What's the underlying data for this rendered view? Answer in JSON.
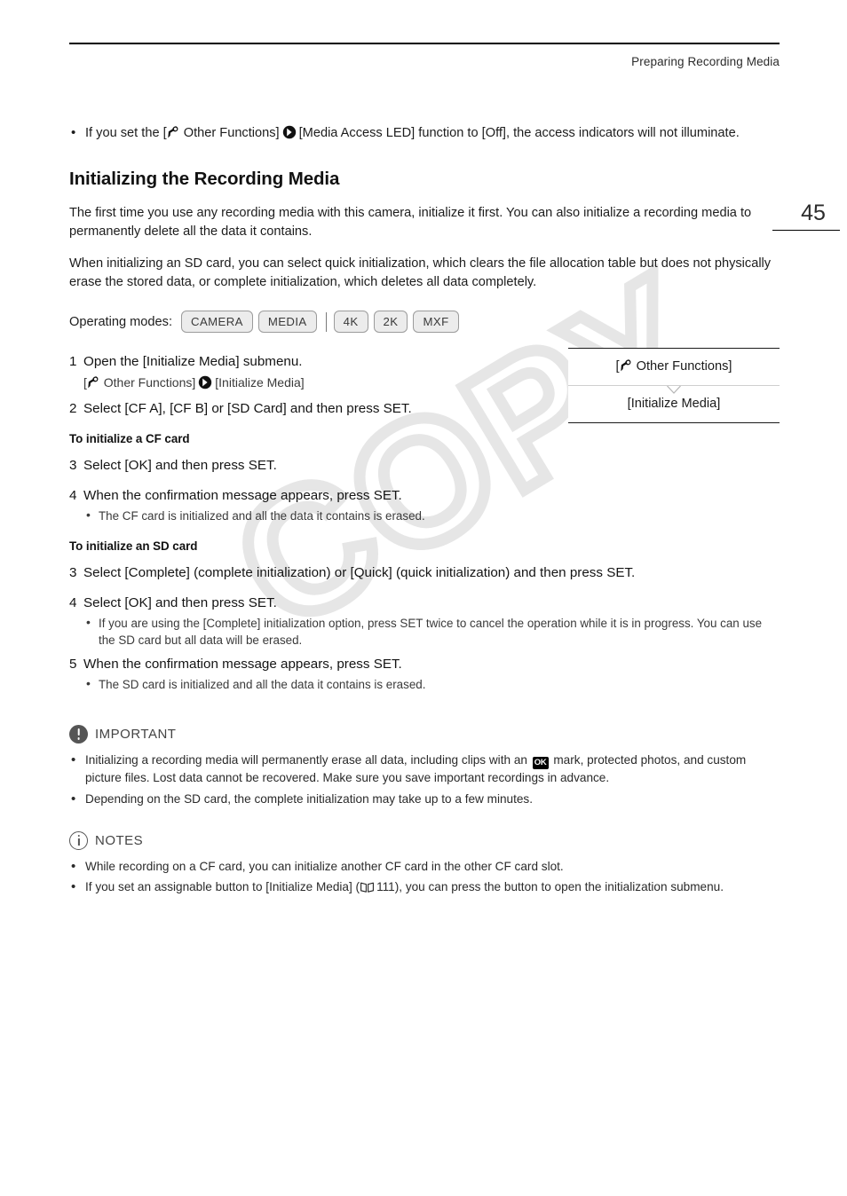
{
  "page": {
    "header_title": "Preparing Recording Media",
    "page_number": "45",
    "watermark": "COPY"
  },
  "intro_bullet": {
    "text_before_wrench": "If you set the [",
    "text_after_wrench": "Other Functions]",
    "text_after_arrow": "[Media Access LED] function to [Off], the access indicators will not illuminate."
  },
  "section": {
    "title": "Initializing the Recording Media",
    "para1": "The first time you use any recording media with this camera, initialize it first. You can also initialize a recording media to permanently delete all the data it contains.",
    "para2": "When initializing an SD card, you can select quick initialization, which clears the file allocation table but does not physically erase the stored data, or complete initialization, which deletes all data completely."
  },
  "operating_modes": {
    "label": "Operating modes:",
    "badges_primary": [
      "CAMERA",
      "MEDIA"
    ],
    "badges_secondary": [
      "4K",
      "2K",
      "MXF"
    ]
  },
  "steps_common": [
    {
      "num": "1",
      "text": "Open the [Initialize Media] submenu.",
      "sub_before_wrench": "[",
      "sub_after_wrench": "Other Functions]",
      "sub_after_arrow": "[Initialize Media]"
    },
    {
      "num": "2",
      "text": "Select [CF A], [CF B] or [SD Card] and then press SET."
    }
  ],
  "menu_path_box": {
    "row1_before_wrench": "[",
    "row1_after_wrench": "Other Functions]",
    "row2": "[Initialize Media]"
  },
  "cf_section": {
    "subhead": "To initialize a CF card",
    "steps": [
      {
        "num": "3",
        "text": "Select [OK] and then press SET.",
        "bullets": []
      },
      {
        "num": "4",
        "text": "When the confirmation message appears, press SET.",
        "bullets": [
          "The CF card is initialized and all the data it contains is erased."
        ]
      }
    ]
  },
  "sd_section": {
    "subhead": "To initialize an SD card",
    "steps": [
      {
        "num": "3",
        "text": "Select [Complete] (complete initialization) or [Quick] (quick initialization) and then press SET.",
        "bullets": []
      },
      {
        "num": "4",
        "text": "Select [OK] and then press SET.",
        "bullets": [
          "If you are using the [Complete] initialization option, press SET twice to cancel the operation while it is in progress. You can use the SD card but all data will be erased."
        ]
      },
      {
        "num": "5",
        "text": "When the confirmation message appears, press SET.",
        "bullets": [
          "The SD card is initialized and all the data it contains is erased."
        ]
      }
    ]
  },
  "important": {
    "label": "IMPORTANT",
    "bullet1_before_ok": "Initializing a recording media will permanently erase all data, including clips with an",
    "ok_mark": "OK",
    "bullet1_after_ok": "mark, protected photos, and custom picture files. Lost data cannot be recovered. Make sure you save important recordings in advance.",
    "bullet2": "Depending on the SD card, the complete initialization may take up to a few minutes."
  },
  "notes": {
    "label": "NOTES",
    "bullet1": "While recording on a CF card, you can initialize another CF card in the other CF card slot.",
    "bullet2_before_book": "If you set an assignable button to [Initialize Media] (",
    "page_ref": "111",
    "bullet2_after_ref": "), you can press the button to open the initialization submenu."
  }
}
